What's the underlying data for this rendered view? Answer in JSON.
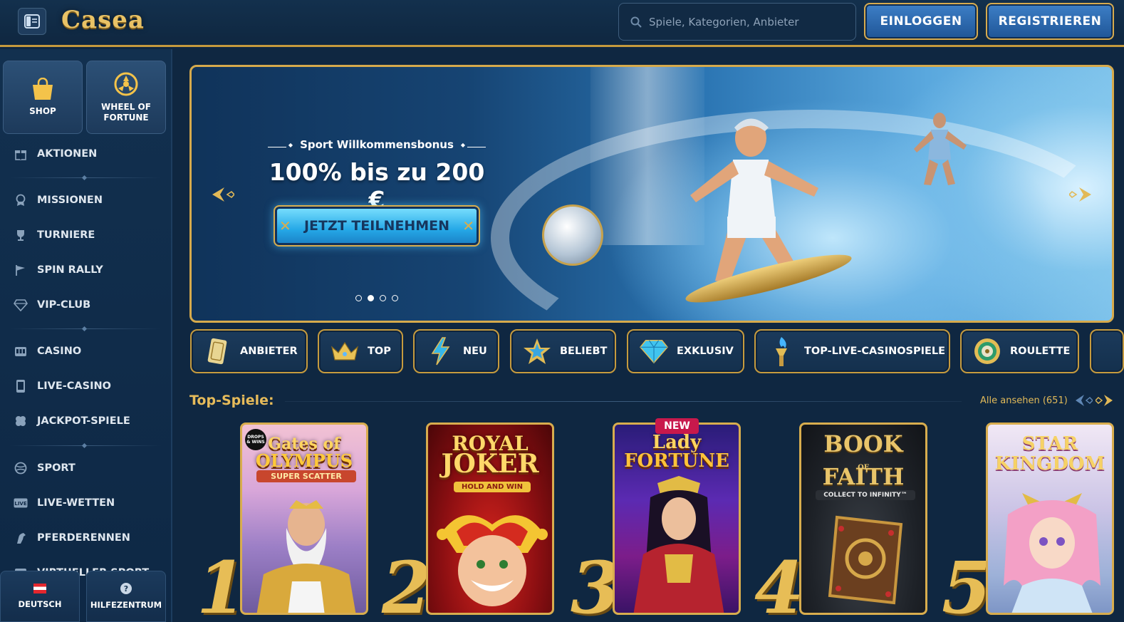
{
  "header": {
    "logo_text": "Casea",
    "search_placeholder": "Spiele, Kategorien, Anbieter",
    "login_label": "EINLOGGEN",
    "register_label": "REGISTRIEREN"
  },
  "sidebar": {
    "tiles": [
      {
        "label": "SHOP",
        "icon": "shopping-bag-icon"
      },
      {
        "label": "WHEEL OF FORTUNE",
        "icon": "wheel-icon"
      }
    ],
    "items": [
      {
        "label": "AKTIONEN",
        "icon": "gift-icon"
      },
      {
        "label": "MISSIONEN",
        "icon": "medal-icon"
      },
      {
        "label": "TURNIERE",
        "icon": "trophy-icon"
      },
      {
        "label": "SPIN RALLY",
        "icon": "flag-icon"
      },
      {
        "label": "VIP-CLUB",
        "icon": "diamond-icon"
      },
      {
        "label": "CASINO",
        "icon": "slot-machine-icon"
      },
      {
        "label": "LIVE-CASINO",
        "icon": "phone-card-icon"
      },
      {
        "label": "JACKPOT-SPIELE",
        "icon": "clover-icon"
      },
      {
        "label": "SPORT",
        "icon": "ball-icon"
      },
      {
        "label": "LIVE-WETTEN",
        "icon": "live-icon"
      },
      {
        "label": "PFERDERENNEN",
        "icon": "horse-icon"
      },
      {
        "label": "VIRTUELLER SPORT",
        "icon": "virtual-sport-icon"
      }
    ],
    "bottom": {
      "language_label": "DEUTSCH",
      "help_label": "HILFEZENTRUM"
    }
  },
  "banner": {
    "kicker": "Sport Willkommensbonus",
    "title": "100% bis zu 200 €",
    "cta_label": "JETZT TEILNEHMEN",
    "slides_total": 4,
    "active_slide": 2
  },
  "categories": [
    {
      "label": "ANBIETER",
      "icon": "card-icon"
    },
    {
      "label": "TOP",
      "icon": "crown-icon"
    },
    {
      "label": "NEU",
      "icon": "lightning-icon"
    },
    {
      "label": "BELIEBT",
      "icon": "star-icon"
    },
    {
      "label": "EXKLUSIV",
      "icon": "diamond-icon"
    },
    {
      "label": "TOP-LIVE-CASINOSPIELE",
      "icon": "torch-icon"
    },
    {
      "label": "ROULETTE",
      "icon": "roulette-icon"
    }
  ],
  "top_games": {
    "title": "Top-Spiele:",
    "see_all_label": "Alle ansehen (651)",
    "games": [
      {
        "rank": "1",
        "title_line1": "Gates of",
        "title_line2": "OLYMPUS",
        "subtitle": "SUPER SCATTER",
        "badge": "DROPS & WINS"
      },
      {
        "rank": "2",
        "title_line1": "ROYAL",
        "title_line2": "JOKER",
        "subtitle": "HOLD AND WIN"
      },
      {
        "rank": "3",
        "title_line1": "Lady",
        "title_line2": "FORTUNE",
        "badge": "NEW"
      },
      {
        "rank": "4",
        "title_line1": "BOOK",
        "title_line2": "FAITH",
        "subtitle": "COLLECT TO INFINITY™",
        "connector": "OF"
      },
      {
        "rank": "5",
        "title_line1": "STAR",
        "title_line2": "KINGDOM"
      }
    ]
  },
  "colors": {
    "background": "#0f2741",
    "gold": "#d6aa4c",
    "button_blue": "#2a67b0",
    "new_badge": "#c8194c"
  }
}
